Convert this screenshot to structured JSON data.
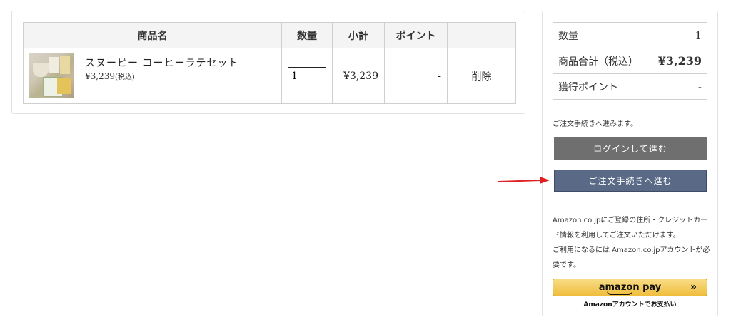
{
  "cart": {
    "headers": {
      "product": "商品名",
      "quantity": "数量",
      "subtotal": "小計",
      "points": "ポイント",
      "action": ""
    },
    "items": [
      {
        "name": "スヌーピー コーヒーラテセット",
        "price": "¥3,239",
        "price_tax_note": "(税込)",
        "quantity": "1",
        "subtotal": "¥3,239",
        "points": "-",
        "delete_label": "削除",
        "thumbnail": "snoopy-coffee-latte-set-photo"
      }
    ]
  },
  "summary": {
    "quantity_label": "数量",
    "quantity_value": "1",
    "total_label": "商品合計（税込）",
    "total_value": "¥3,239",
    "points_label": "獲得ポイント",
    "points_value": "-",
    "proceed_note": "ご注文手続きへ進みます。",
    "login_button": "ログインして進む",
    "checkout_button": "ご注文手続きへ進む",
    "amazon_note_1": "Amazon.co.jpにご登録の住所・クレジットカード情報を利用してご注文いただけます。",
    "amazon_note_2": "ご利用になるには Amazon.co.jpアカウントが必要です。",
    "amazon_button_logo": "amazon pay",
    "amazon_button_chevron": "»",
    "amazon_caption": "Amazonアカウントでお支払い"
  },
  "colors": {
    "login_button": "#6f6f6f",
    "checkout_button": "#5a6a86",
    "amazon_gold": "#efbd3c",
    "annotation_arrow": "#e02020"
  },
  "annotation": {
    "icon": "red-arrow-icon"
  }
}
